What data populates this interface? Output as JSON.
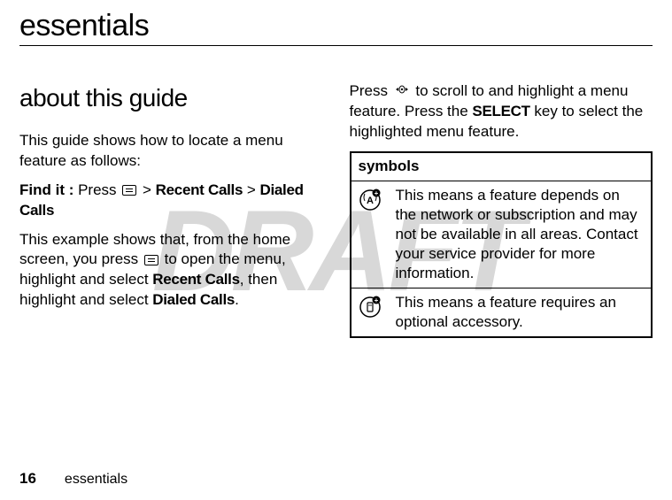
{
  "watermark": "DRAFT",
  "title": "essentials",
  "section_heading": "about this guide",
  "col1": {
    "intro": "This guide shows how to locate a menu feature as follows:",
    "findit_label": "Find it :",
    "findit_press": " Press ",
    "gt1": " > ",
    "recent_calls": "Recent Calls",
    "gt2": " > ",
    "dialed_calls": "Dialed Calls",
    "example_p1a": "This example shows that, from the home screen, you press ",
    "example_p1b": " to open the menu, highlight and select ",
    "recent_calls2": "Recent Calls",
    "example_p1c": ", then highlight and select ",
    "dialed_calls2": "Dialed Calls",
    "example_p1d": "."
  },
  "col2": {
    "press_a": "Press ",
    "press_b": " to scroll to and highlight a menu feature. Press the ",
    "select_key": "SELECT",
    "press_c": " key to select the highlighted menu feature.",
    "symbols_header": "symbols",
    "row1_desc": "This means a feature depends on the network or subscription and may not be available in all areas. Contact your service provider for more information.",
    "row2_desc": "This means a feature requires an optional accessory."
  },
  "footer": {
    "page_num": "16",
    "label": "essentials"
  }
}
